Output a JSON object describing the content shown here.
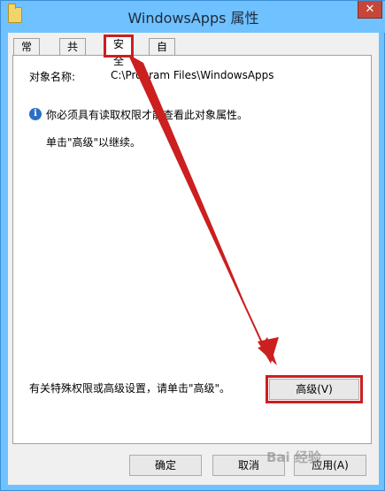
{
  "window": {
    "title": "WindowsApps 属性",
    "close_glyph": "✕"
  },
  "tabs": [
    {
      "label": "常规"
    },
    {
      "label": "共享"
    },
    {
      "label": "安全"
    },
    {
      "label": "自定义"
    }
  ],
  "security": {
    "object_name_label": "对象名称:",
    "object_name_value": "C:\\Program Files\\WindowsApps",
    "info_message": "你必须具有读取权限才能查看此对象属性。",
    "continue_hint": "单击\"高级\"以继续。",
    "advanced_hint": "有关特殊权限或高级设置，请单击\"高级\"。",
    "advanced_button": "高级(V)"
  },
  "footer": {
    "ok_button": "确定",
    "cancel_button": "取消",
    "apply_button": "应用(A)"
  },
  "watermark": "Bai 经验",
  "colors": {
    "highlight": "#cc1f1f",
    "titlebar": "#6fc1ff"
  },
  "icons": {
    "folder": "folder-icon",
    "info": "info-icon",
    "close": "close-icon"
  }
}
